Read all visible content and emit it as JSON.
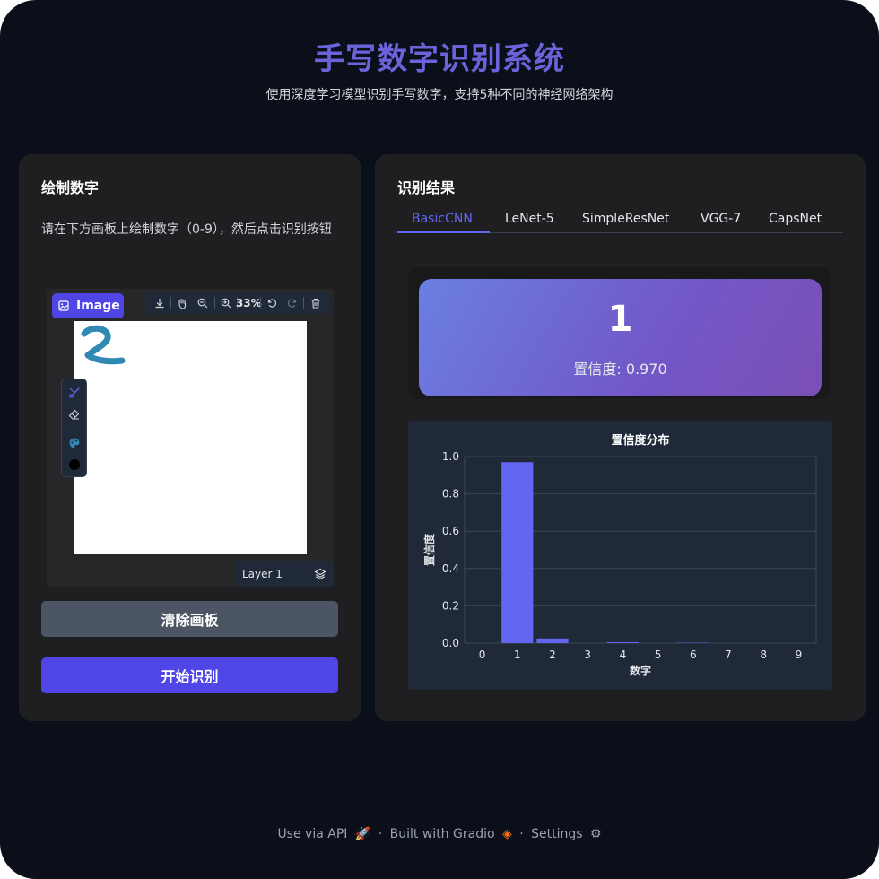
{
  "header": {
    "title": "手写数字识别系统",
    "subtitle": "使用深度学习模型识别手写数字，支持5种不同的神经网络架构"
  },
  "left_panel": {
    "title": "绘制数字",
    "instruction": "请在下方画板上绘制数字（0-9），然后点击识别按钮",
    "image_badge": "Image",
    "zoom_level": "33%",
    "layer_label": "Layer 1",
    "clear_button": "清除画板",
    "start_button": "开始识别",
    "stroke_color": "#2f89b3"
  },
  "right_panel": {
    "title": "识别结果",
    "tabs": [
      {
        "label": "BasicCNN",
        "active": true
      },
      {
        "label": "LeNet-5",
        "active": false
      },
      {
        "label": "SimpleResNet",
        "active": false
      },
      {
        "label": "VGG-7",
        "active": false
      },
      {
        "label": "CapsNet",
        "active": false
      }
    ],
    "prediction": "1",
    "confidence_text": "置信度: 0.970"
  },
  "chart_data": {
    "type": "bar",
    "title": "置信度分布",
    "xlabel": "数字",
    "ylabel": "置信度",
    "categories": [
      "0",
      "1",
      "2",
      "3",
      "4",
      "5",
      "6",
      "7",
      "8",
      "9"
    ],
    "values": [
      0.0,
      0.97,
      0.025,
      0.0,
      0.005,
      0.0,
      0.002,
      0.0,
      0.0,
      0.0
    ],
    "ylim": [
      0,
      1.0
    ],
    "yticks": [
      "0.0",
      "0.2",
      "0.4",
      "0.6",
      "0.8",
      "1.0"
    ],
    "grid": true,
    "bar_color": "#6366f1"
  },
  "footer": {
    "api": "Use via API",
    "built": "Built with Gradio",
    "settings": "Settings"
  },
  "colors": {
    "accent": "#4f46e5",
    "background": "#0b0f19",
    "panel": "#1f1f21"
  }
}
